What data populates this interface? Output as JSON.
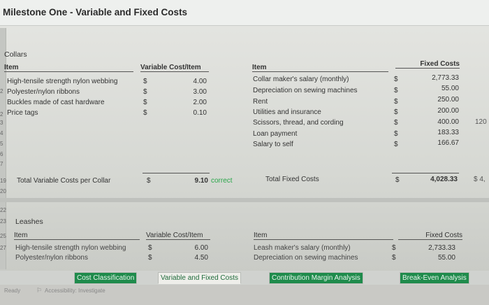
{
  "title": "Milestone One - Variable and Fixed Costs",
  "collars": {
    "section": "Collars",
    "item_header": "Item",
    "variable_header": "Variable Cost/Item",
    "variable_items": [
      {
        "label": "High-tensile strength nylon webbing",
        "currency": "$",
        "value": "4.00"
      },
      {
        "label": "Polyester/nylon ribbons",
        "currency": "$",
        "value": "3.00"
      },
      {
        "label": "Buckles made of cast hardware",
        "currency": "$",
        "value": "2.00"
      },
      {
        "label": "Price tags",
        "currency": "$",
        "value": "0.10"
      }
    ],
    "fixed_item_header": "Item",
    "fixed_header": "Fixed Costs",
    "fixed_items": [
      {
        "label": "Collar maker's salary (monthly)",
        "currency": "$",
        "value": "2,773.33"
      },
      {
        "label": "Depreciation on sewing machines",
        "currency": "$",
        "value": "55.00"
      },
      {
        "label": "Rent",
        "currency": "$",
        "value": "250.00"
      },
      {
        "label": "Utilities and insurance",
        "currency": "$",
        "value": "200.00"
      },
      {
        "label": "Scissors, thread, and cording",
        "currency": "$",
        "value": "400.00"
      },
      {
        "label": "Loan payment",
        "currency": "$",
        "value": "183.33"
      },
      {
        "label": "Salary to self",
        "currency": "$",
        "value": "166.67"
      }
    ],
    "total_variable_label": "Total Variable Costs per Collar",
    "total_variable_currency": "$",
    "total_variable_value": "9.10",
    "total_variable_check": "correct",
    "total_fixed_label": "Total Fixed Costs",
    "total_fixed_currency": "$",
    "total_fixed_value": "4,028.33",
    "right_clip_1": "120",
    "right_clip_2": "$ 4,"
  },
  "leashes": {
    "section": "Leashes",
    "item_header": "Item",
    "variable_header": "Variable Cost/Item",
    "variable_items": [
      {
        "label": "High-tensile strength nylon webbing",
        "currency": "$",
        "value": "6.00"
      },
      {
        "label": "Polyester/nylon ribbons",
        "currency": "$",
        "value": "4.50"
      }
    ],
    "fixed_item_header": "Item",
    "fixed_header": "Fixed Costs",
    "fixed_items": [
      {
        "label": "Leash maker's salary (monthly)",
        "currency": "$",
        "value": "2,733.33"
      },
      {
        "label": "Depreciation on sewing machines",
        "currency": "$",
        "value": "55.00"
      }
    ]
  },
  "row_numbers": [
    "2",
    "3",
    "4",
    "5",
    "6",
    "7",
    "19",
    "20",
    "22",
    "23",
    "25",
    "27"
  ],
  "tabs": [
    "Cost Classification",
    "Variable and Fixed Costs",
    "Contribution Margin Analysis",
    "Break-Even Analysis"
  ],
  "status": {
    "ready": "Ready",
    "accessibility": "Accessibility: Investigate"
  },
  "colors": {
    "tab_green": "#1f8b4c",
    "correct": "#2aa64a"
  }
}
